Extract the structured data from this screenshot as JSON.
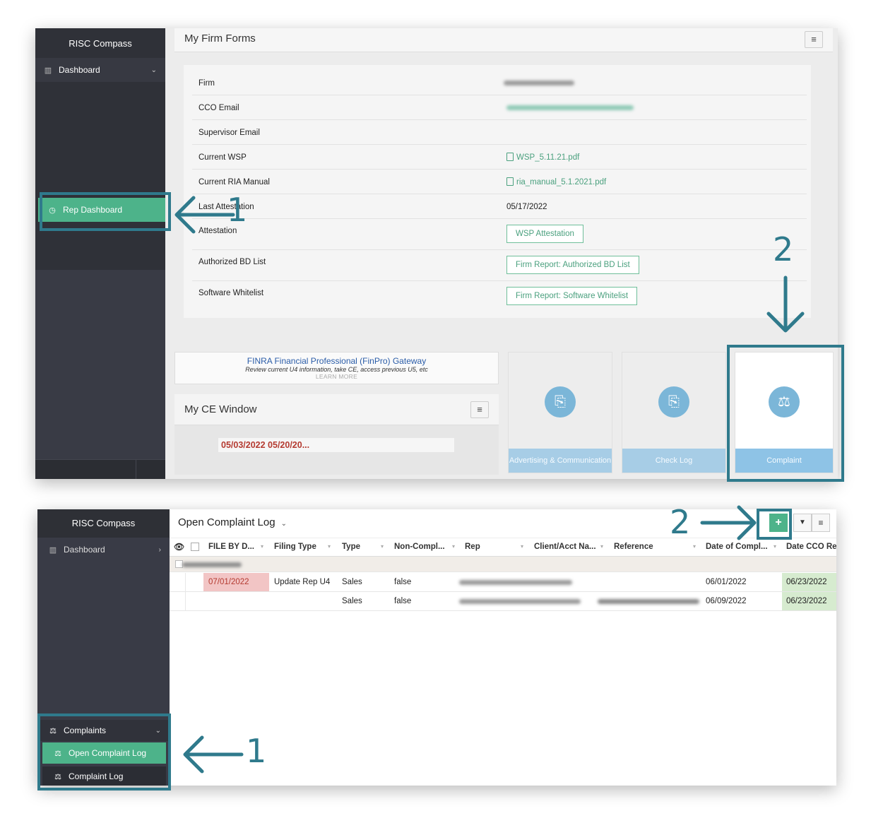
{
  "panel_top": {
    "app_title": "RISC Compass",
    "sidebar": {
      "dashboard_label": "Dashboard",
      "rep_dashboard_label": "Rep Dashboard"
    },
    "header_title": "My Firm Forms",
    "form_rows": [
      {
        "label": "Firm",
        "value": ""
      },
      {
        "label": "CCO Email",
        "value": ""
      },
      {
        "label": "Supervisor Email",
        "value": ""
      },
      {
        "label": "Current WSP",
        "value": "WSP_5.11.21.pdf"
      },
      {
        "label": "Current RIA Manual",
        "value": "ria_manual_5.1.2021.pdf"
      },
      {
        "label": "Last Attestation",
        "value": "05/17/2022"
      },
      {
        "label": "Attestation",
        "value": "WSP Attestation"
      },
      {
        "label": "Authorized BD List",
        "value": "Firm Report: Authorized BD List"
      },
      {
        "label": "Software Whitelist",
        "value": "Firm Report: Software Whitelist"
      }
    ],
    "finpro": {
      "title": "FINRA Financial Professional (FinPro) Gateway",
      "subtitle": "Review current U4 information, take CE, access previous U5, etc",
      "learn_more": "LEARN MORE"
    },
    "ce_window": {
      "title": "My CE Window",
      "dates": "05/03/2022  05/20/20..."
    },
    "tiles": [
      {
        "label": "Advertising & Communication",
        "icon": "money-document-icon"
      },
      {
        "label": "Check Log",
        "icon": "money-document-icon"
      },
      {
        "label": "Complaint",
        "icon": "gavel-icon"
      }
    ],
    "annotations": {
      "step1": "1",
      "step2": "2"
    }
  },
  "panel_bottom": {
    "app_title": "RISC Compass",
    "sidebar": {
      "dashboard_label": "Dashboard",
      "complaints_label": "Complaints",
      "open_complaint_log_label": "Open Complaint Log",
      "complaint_log_label": "Complaint Log"
    },
    "page_title": "Open Complaint Log",
    "toolbar": {
      "add": "+",
      "filter": "▼",
      "menu": "≡"
    },
    "columns": [
      "FILE BY D...",
      "Filing Type",
      "Type",
      "Non-Compl...",
      "Rep",
      "Client/Acct Na...",
      "Reference",
      "Date of Compl...",
      "Date CCO Re"
    ],
    "rows": [
      {
        "file_by": "07/01/2022",
        "filing_type": "Update Rep U4",
        "type": "Sales",
        "non_compliant": "false",
        "date_of_complaint": "06/01/2022",
        "date_cco": "06/23/2022"
      },
      {
        "file_by": "",
        "filing_type": "",
        "type": "Sales",
        "non_compliant": "false",
        "date_of_complaint": "06/09/2022",
        "date_cco": "06/23/2022"
      }
    ],
    "annotations": {
      "step1": "1",
      "step2": "2"
    }
  },
  "colors": {
    "accent_green": "#4db38a",
    "highlight_blue": "#2f7a8c",
    "tile_blue": "#7bb6d8",
    "overdue_red": "#b43a30"
  }
}
